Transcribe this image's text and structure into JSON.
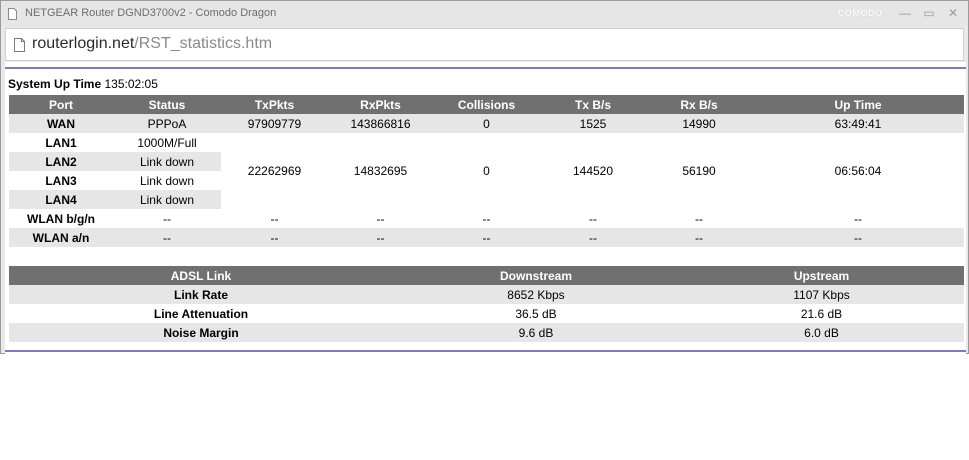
{
  "window": {
    "title": "NETGEAR Router DGND3700v2 - Comodo Dragon",
    "brand": "COMODO",
    "url_host": "routerlogin.net",
    "url_path": "/RST_statistics.htm"
  },
  "uptime": {
    "label": "System Up Time",
    "value": "135:02:05"
  },
  "stats": {
    "headers": [
      "Port",
      "Status",
      "TxPkts",
      "RxPkts",
      "Collisions",
      "Tx B/s",
      "Rx B/s",
      "Up Time"
    ],
    "wan": {
      "port": "WAN",
      "status": "PPPoA",
      "txpkts": "97909779",
      "rxpkts": "143866816",
      "collisions": "0",
      "txbs": "1525",
      "rxbs": "14990",
      "uptime": "63:49:41"
    },
    "lan": {
      "ports": [
        {
          "port": "LAN1",
          "status": "1000M/Full"
        },
        {
          "port": "LAN2",
          "status": "Link down"
        },
        {
          "port": "LAN3",
          "status": "Link down"
        },
        {
          "port": "LAN4",
          "status": "Link down"
        }
      ],
      "txpkts": "22262969",
      "rxpkts": "14832695",
      "collisions": "0",
      "txbs": "144520",
      "rxbs": "56190",
      "uptime": "06:56:04"
    },
    "wlan_bgn": {
      "port": "WLAN b/g/n",
      "status": "--",
      "txpkts": "--",
      "rxpkts": "--",
      "collisions": "--",
      "txbs": "--",
      "rxbs": "--",
      "uptime": "--"
    },
    "wlan_an": {
      "port": "WLAN a/n",
      "status": "--",
      "txpkts": "--",
      "rxpkts": "--",
      "collisions": "--",
      "txbs": "--",
      "rxbs": "--",
      "uptime": "--"
    }
  },
  "adsl": {
    "headers": [
      "ADSL Link",
      "Downstream",
      "Upstream"
    ],
    "rows": [
      {
        "label": "Link Rate",
        "down": "8652 Kbps",
        "up": "1107 Kbps"
      },
      {
        "label": "Line Attenuation",
        "down": "36.5 dB",
        "up": "21.6 dB"
      },
      {
        "label": "Noise Margin",
        "down": "9.6 dB",
        "up": "6.0 dB"
      }
    ]
  },
  "icons": {
    "title": "page-icon",
    "address": "page-icon",
    "minimize": "minimize-icon",
    "maximize": "maximize-icon",
    "close": "close-icon"
  },
  "colors": {
    "header_bg": "#707070",
    "row_shade": "#e6e6e6",
    "rule": "#7b7bc1"
  },
  "glyphs": {
    "minimize": "—",
    "maximize": "▭",
    "close": "✕"
  }
}
